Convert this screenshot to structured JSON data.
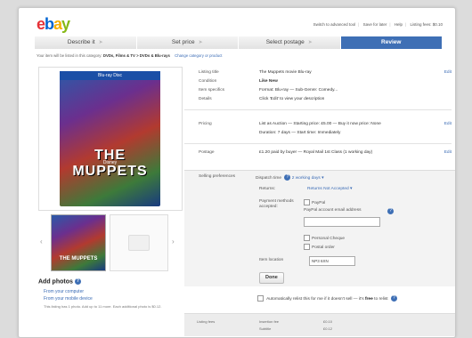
{
  "brand": {
    "logo_parts": [
      "e",
      "b",
      "a",
      "y"
    ],
    "colors": [
      "#e53238",
      "#0064d2",
      "#f5af02",
      "#86b817"
    ]
  },
  "topnav": [
    "Switch to advanced tool",
    "Save for later",
    "Help",
    "Listing fees: $0.10"
  ],
  "steps": [
    {
      "label": "Describe it",
      "active": false
    },
    {
      "label": "Set price",
      "active": false
    },
    {
      "label": "Select postage",
      "active": false
    },
    {
      "label": "Review",
      "active": true
    }
  ],
  "category": {
    "prefix": "Your item will be listed in this category:",
    "path": "DVDs, Films & TV > DVDs & Blu-rays",
    "change_link": "Change category or product"
  },
  "product_image": {
    "format_banner": "Blu-ray Disc",
    "tagline": "Disney",
    "title": "THE MUPPETS"
  },
  "add_photos": {
    "title": "Add photos",
    "link_computer": "From your computer",
    "link_mobile": "From your mobile device",
    "note": "This listing has 1 photo. Add up to 11 more. Each additional photo is $0.12."
  },
  "details": [
    {
      "label": "Listing title",
      "value": "The Muppets movie Blu-ray",
      "edit": "Edit"
    },
    {
      "label": "Condition",
      "value": "Like New",
      "edit": ""
    },
    {
      "label": "Item specifics",
      "value": "Format: Blu-ray — Sub-Genre: Comedy...",
      "edit": ""
    },
    {
      "label": "Details",
      "value": "Click 'Edit' to view your description",
      "edit": ""
    }
  ],
  "pricing": {
    "label": "Pricing",
    "line1": "List as Auction — Starting price: £5.00 — Buy it now price: None",
    "line2": "Duration: 7 days — Start time: Immediately",
    "edit": "Edit"
  },
  "postage": {
    "label": "Postage",
    "value": "£1.20 paid by buyer — Royal Mail 1st Class (1 working day)",
    "edit": "Edit"
  },
  "selling_preferences": {
    "label": "Selling preferences",
    "dispatch_label": "Dispatch time",
    "dispatch_value": "2 working days",
    "returns_label": "Returns:",
    "returns_value": "Returns Not Accepted",
    "payment_label": "Payment methods accepted:",
    "paypal": "PayPal",
    "paypal_email_label": "PayPal account email address",
    "paypal_email_value": "",
    "personal_cheque": "Personal Cheque",
    "postal_order": "Postal order",
    "item_location_label": "Item location",
    "item_location_value": "NP3 6XN",
    "done": "Done"
  },
  "relist": {
    "text": "Automatically relist this for me if it doesn't sell — it's",
    "bold": "free",
    "tail": "to relist"
  },
  "bottom": {
    "left_label": "Listing fees",
    "mid1": "Insertion fee",
    "mid2": "Subtitle",
    "val1": "£0.10",
    "val2": "£0.12"
  }
}
